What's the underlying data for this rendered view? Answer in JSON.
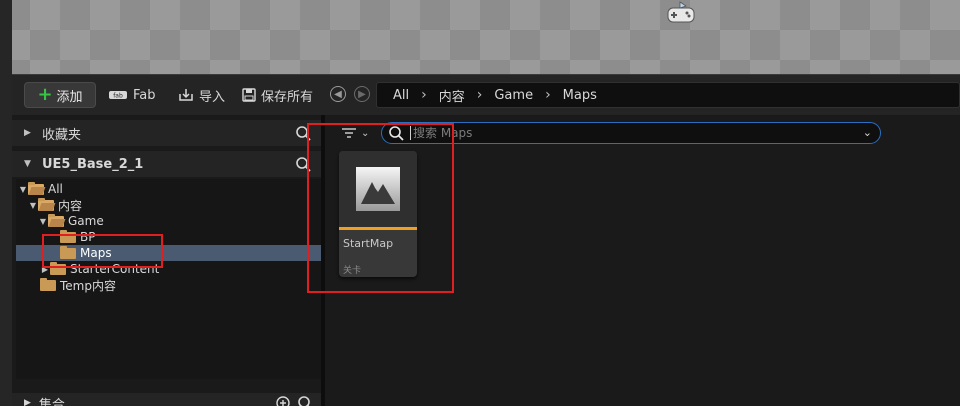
{
  "toolbar": {
    "add_label": "添加",
    "fab_label": "Fab",
    "import_label": "导入",
    "save_all_label": "保存所有"
  },
  "breadcrumb": {
    "items": [
      "All",
      "内容",
      "Game",
      "Maps"
    ]
  },
  "left_panel": {
    "favorites_label": "收藏夹",
    "project_label": "UE5_Base_2_1",
    "tree": [
      {
        "label": "All",
        "depth": 0,
        "expanded": true
      },
      {
        "label": "内容",
        "depth": 1,
        "expanded": true
      },
      {
        "label": "Game",
        "depth": 2,
        "expanded": true
      },
      {
        "label": "BP",
        "depth": 3,
        "expanded": false
      },
      {
        "label": "Maps",
        "depth": 3,
        "expanded": false,
        "selected": true
      },
      {
        "label": "StarterContent",
        "depth": 2,
        "expanded": false,
        "has_children": true
      },
      {
        "label": "Temp内容",
        "depth": 1,
        "expanded": false
      }
    ],
    "collections_label": "集合"
  },
  "right_panel": {
    "search_placeholder": "搜索 Maps",
    "assets": [
      {
        "name": "StartMap",
        "type": "关卡"
      }
    ]
  },
  "colors": {
    "accent_blue": "#2b6ec2",
    "asset_bar": "#f0a020",
    "add_plus": "#36c447",
    "selection": "#4a5a70",
    "annotation": "#e02020"
  }
}
